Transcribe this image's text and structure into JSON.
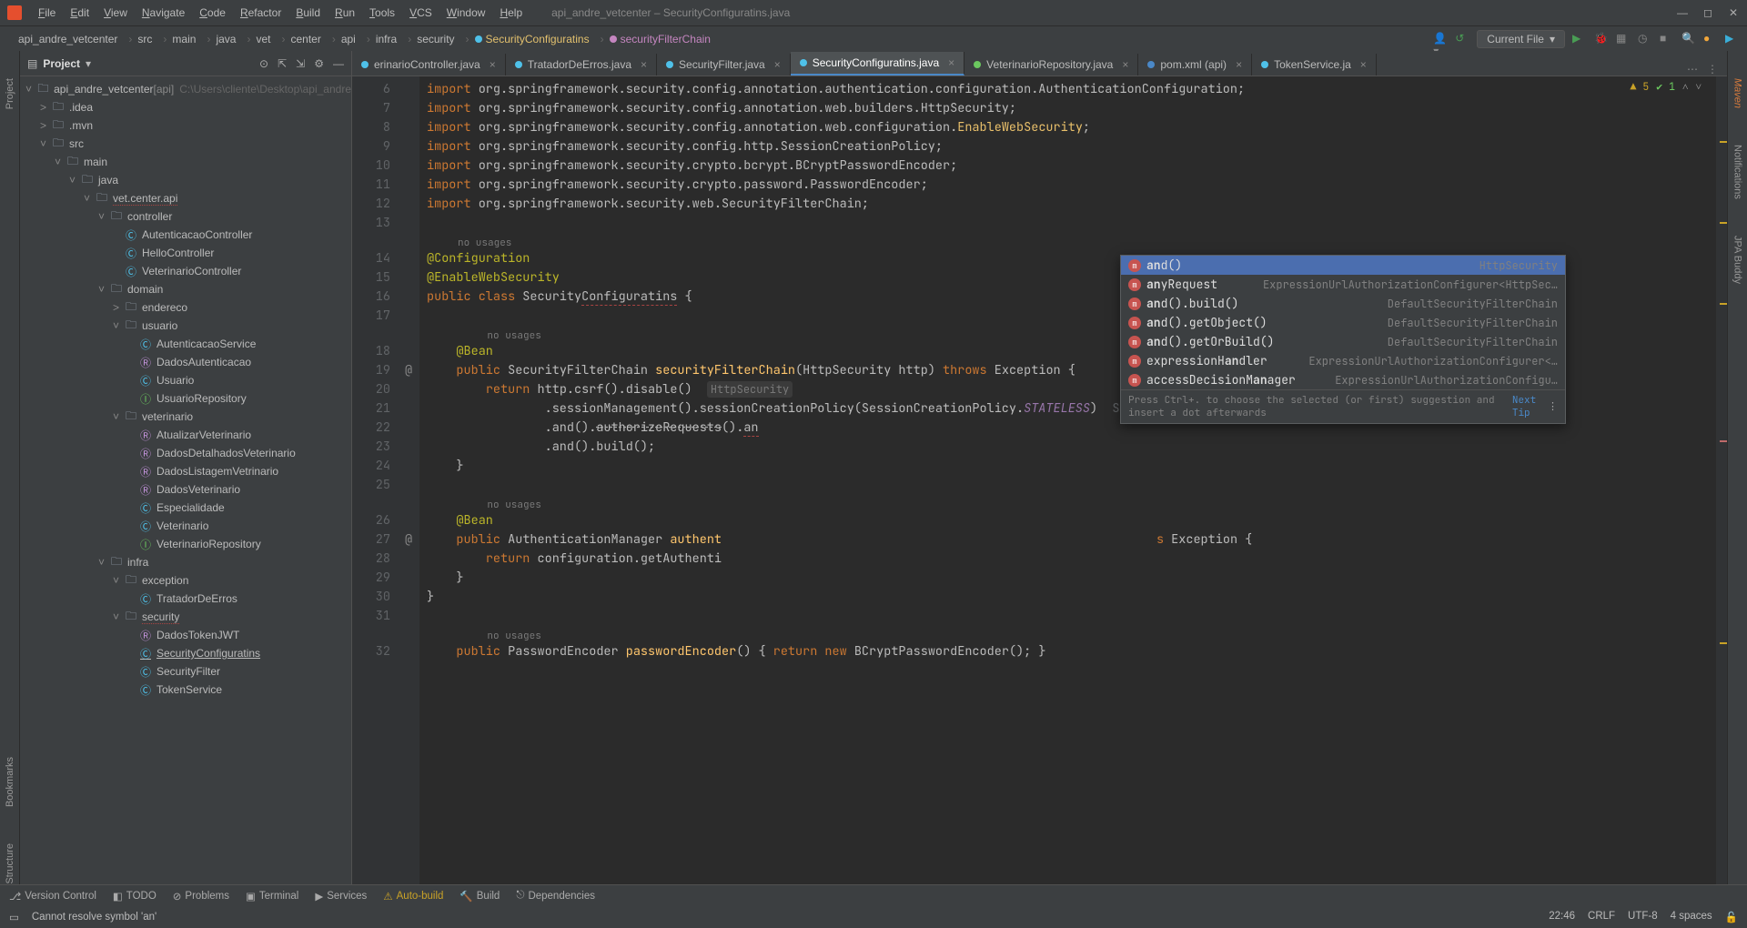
{
  "titlebar": {
    "menus": [
      "File",
      "Edit",
      "View",
      "Navigate",
      "Code",
      "Refactor",
      "Build",
      "Run",
      "Tools",
      "VCS",
      "Window",
      "Help"
    ],
    "title": "api_andre_vetcenter – SecurityConfiguratins.java"
  },
  "breadcrumbs": [
    "api_andre_vetcenter",
    "src",
    "main",
    "java",
    "vet",
    "center",
    "api",
    "infra",
    "security",
    "SecurityConfiguratins",
    "securityFilterChain"
  ],
  "run": {
    "config": "Current File"
  },
  "project": {
    "title": "Project",
    "root": "api_andre_vetcenter",
    "rootTag": "[api]",
    "rootPath": "C:\\Users\\cliente\\Desktop\\api_andre",
    "items": [
      {
        "d": 1,
        "exp": true,
        "ico": "folder",
        "label": "api_andre_vetcenter",
        "suffix": "[api]",
        "path": true
      },
      {
        "d": 2,
        "exp": false,
        "ico": "folder",
        "label": ".idea"
      },
      {
        "d": 2,
        "exp": false,
        "ico": "folder",
        "label": ".mvn"
      },
      {
        "d": 2,
        "exp": true,
        "ico": "folder",
        "label": "src"
      },
      {
        "d": 3,
        "exp": true,
        "ico": "folder",
        "label": "main"
      },
      {
        "d": 4,
        "exp": true,
        "ico": "folder",
        "label": "java"
      },
      {
        "d": 5,
        "exp": true,
        "ico": "folder",
        "label": "vet.center.api",
        "red": true
      },
      {
        "d": 6,
        "exp": true,
        "ico": "folder",
        "label": "controller"
      },
      {
        "d": 7,
        "ico": "class",
        "label": "AutenticacaoController"
      },
      {
        "d": 7,
        "ico": "class",
        "label": "HelloController"
      },
      {
        "d": 7,
        "ico": "class",
        "label": "VeterinarioController"
      },
      {
        "d": 6,
        "exp": true,
        "ico": "folder",
        "label": "domain"
      },
      {
        "d": 7,
        "exp": false,
        "ico": "folder",
        "label": "endereco"
      },
      {
        "d": 7,
        "exp": true,
        "ico": "folder",
        "label": "usuario"
      },
      {
        "d": 8,
        "ico": "class",
        "label": "AutenticacaoService"
      },
      {
        "d": 8,
        "ico": "record",
        "label": "DadosAutenticacao"
      },
      {
        "d": 8,
        "ico": "class",
        "label": "Usuario"
      },
      {
        "d": 8,
        "ico": "iface",
        "label": "UsuarioRepository"
      },
      {
        "d": 7,
        "exp": true,
        "ico": "folder",
        "label": "veterinario"
      },
      {
        "d": 8,
        "ico": "record",
        "label": "AtualizarVeterinario"
      },
      {
        "d": 8,
        "ico": "record",
        "label": "DadosDetalhadosVeterinario"
      },
      {
        "d": 8,
        "ico": "record",
        "label": "DadosListagemVetrinario"
      },
      {
        "d": 8,
        "ico": "record",
        "label": "DadosVeterinario"
      },
      {
        "d": 8,
        "ico": "class",
        "label": "Especialidade"
      },
      {
        "d": 8,
        "ico": "class",
        "label": "Veterinario"
      },
      {
        "d": 8,
        "ico": "iface",
        "label": "VeterinarioRepository"
      },
      {
        "d": 6,
        "exp": true,
        "ico": "folder",
        "label": "infra"
      },
      {
        "d": 7,
        "exp": true,
        "ico": "folder",
        "label": "exception"
      },
      {
        "d": 8,
        "ico": "class",
        "label": "TratadorDeErros"
      },
      {
        "d": 7,
        "exp": true,
        "ico": "folder",
        "label": "security",
        "red": true
      },
      {
        "d": 8,
        "ico": "record",
        "label": "DadosTokenJWT"
      },
      {
        "d": 8,
        "ico": "class",
        "label": "SecurityConfiguratins",
        "sel": true
      },
      {
        "d": 8,
        "ico": "class",
        "label": "SecurityFilter"
      },
      {
        "d": 8,
        "ico": "class",
        "label": "TokenService"
      }
    ]
  },
  "tabs": [
    {
      "label": "erinarioController.java",
      "ico": "class"
    },
    {
      "label": "TratadorDeErros.java",
      "ico": "class"
    },
    {
      "label": "SecurityFilter.java",
      "ico": "class"
    },
    {
      "label": "SecurityConfiguratins.java",
      "ico": "class",
      "active": true
    },
    {
      "label": "VeterinarioRepository.java",
      "ico": "iface"
    },
    {
      "label": "pom.xml (api)",
      "ico": "xml"
    },
    {
      "label": "TokenService.ja",
      "ico": "class"
    }
  ],
  "inspection": {
    "warnings": "5",
    "passes": "1"
  },
  "code": {
    "lines": [
      {
        "n": 6,
        "html": "<span class='kw'>import</span> org.springframework.security.config.annotation.authentication.configuration.AuthenticationConfiguration;"
      },
      {
        "n": 7,
        "html": "<span class='kw'>import</span> org.springframework.security.config.annotation.web.builders.HttpSecurity;"
      },
      {
        "n": 8,
        "html": "<span class='kw'>import</span> org.springframework.security.config.annotation.web.configuration.<span class='cfg'>EnableWebSecurity</span>;"
      },
      {
        "n": 9,
        "html": "<span class='kw'>import</span> org.springframework.security.config.http.SessionCreationPolicy;"
      },
      {
        "n": 10,
        "html": "<span class='kw'>import</span> org.springframework.security.crypto.bcrypt.BCryptPasswordEncoder;"
      },
      {
        "n": 11,
        "html": "<span class='kw'>import</span> org.springframework.security.crypto.password.PasswordEncoder;"
      },
      {
        "n": 12,
        "html": "<span class='kw'>import</span> org.springframework.security.web.SecurityFilterChain;"
      },
      {
        "n": 13,
        "html": ""
      },
      {
        "n": null,
        "html": "<span class='no-usages'>no usages</span>",
        "noGutter": true,
        "hintRow": true
      },
      {
        "n": 14,
        "html": "<span class='ann'>@Configuration</span>"
      },
      {
        "n": 15,
        "html": "<span class='ann'>@EnableWebSecurity</span>"
      },
      {
        "n": 16,
        "html": "<span class='kw'>public class</span> Security<span class='squig'>Configuratins</span> {"
      },
      {
        "n": 17,
        "html": ""
      },
      {
        "n": null,
        "html": "    <span class='no-usages'>no usages</span>",
        "noGutter": true,
        "hintRow": true
      },
      {
        "n": 18,
        "html": "    <span class='ann'>@Bean</span>"
      },
      {
        "n": 19,
        "g": "@",
        "html": "    <span class='kw'>public</span> SecurityFilterChain <span class='pm'>securityFilterChain</span>(HttpSecurity http) <span class='kw'>throws</span> Exception {"
      },
      {
        "n": 20,
        "html": "        <span class='kw'>return</span> http.csrf().disable()  <span class='hint-box'>HttpSecurity</span>"
      },
      {
        "n": 21,
        "html": "                .sessionManagement().sessionCreationPolicy(SessionCreationPolicy.<span class='italic'>STATELESS</span>)  <span class='hint'>SessionManagementConfigurer&lt;HttpSecurity&gt;</span>"
      },
      {
        "n": 22,
        "html": "                .and().<span class='deprecated'>authorizeRequests</span>().<span class='squig'>an</span>"
      },
      {
        "n": 23,
        "html": "                .and().build();"
      },
      {
        "n": 24,
        "html": "    }"
      },
      {
        "n": 25,
        "html": ""
      },
      {
        "n": null,
        "html": "    <span class='no-usages'>no usages</span>",
        "noGutter": true,
        "hintRow": true
      },
      {
        "n": 26,
        "html": "    <span class='ann'>@Bean</span>"
      },
      {
        "n": 27,
        "g": "@",
        "html": "    <span class='kw'>public</span> AuthenticationManager <span class='pm'>authent</span>                                                           <span class='kw'>s</span> Exception {"
      },
      {
        "n": 28,
        "html": "        <span class='kw'>return</span> configuration.getAuthenti"
      },
      {
        "n": 29,
        "html": "    }"
      },
      {
        "n": 30,
        "html": "}"
      },
      {
        "n": 31,
        "html": ""
      },
      {
        "n": null,
        "html": "    <span class='no-usages'>no usages</span>",
        "noGutter": true,
        "hintRow": true
      },
      {
        "n": 32,
        "html": "    <span class='kw'>public</span> PasswordEncoder <span class='pm'>passwordEncoder</span>() { <span class='kw'>return new</span> BCryptPasswordEncoder(); }"
      }
    ]
  },
  "autocomplete": {
    "items": [
      {
        "name": "and()",
        "ret": "HttpSecurity",
        "sel": true,
        "hl": "an"
      },
      {
        "name": "anyRequest",
        "ret": "ExpressionUrlAuthorizationConfigurer<HttpSec…",
        "hl": "an"
      },
      {
        "name": "and().build()",
        "ret": "DefaultSecurityFilterChain",
        "hl": "an"
      },
      {
        "name": "and().getObject()",
        "ret": "DefaultSecurityFilterChain",
        "hl": "an"
      },
      {
        "name": "and().getOrBuild()",
        "ret": "DefaultSecurityFilterChain",
        "hl": "an"
      },
      {
        "name": "expressionHandler",
        "ret": "ExpressionUrlAuthorizationConfigurer<…",
        "hl": "an"
      },
      {
        "name": "accessDecisionManager",
        "ret": "ExpressionUrlAuthorizationConfigu…",
        "hl": "an"
      }
    ],
    "footer": "Press Ctrl+. to choose the selected (or first) suggestion and insert a dot afterwards",
    "footerLink": "Next Tip"
  },
  "toolwins": [
    {
      "label": "Version Control",
      "ico": "⎇"
    },
    {
      "label": "TODO",
      "ico": "◧"
    },
    {
      "label": "Problems",
      "ico": "⊘"
    },
    {
      "label": "Terminal",
      "ico": "▣"
    },
    {
      "label": "Services",
      "ico": "▶"
    },
    {
      "label": "Auto-build",
      "ico": "⚠",
      "warn": true
    },
    {
      "label": "Build",
      "ico": "🔨"
    },
    {
      "label": "Dependencies",
      "ico": "⎋"
    }
  ],
  "status": {
    "error": "Cannot resolve symbol 'an'",
    "time": "22:46",
    "sep": "CRLF",
    "enc": "UTF-8",
    "indent": "4 spaces"
  },
  "rightStrip": [
    "Maven",
    "Notifications",
    "JPA Buddy"
  ],
  "leftStrip": [
    "Project",
    "Bookmarks",
    "Structure"
  ]
}
